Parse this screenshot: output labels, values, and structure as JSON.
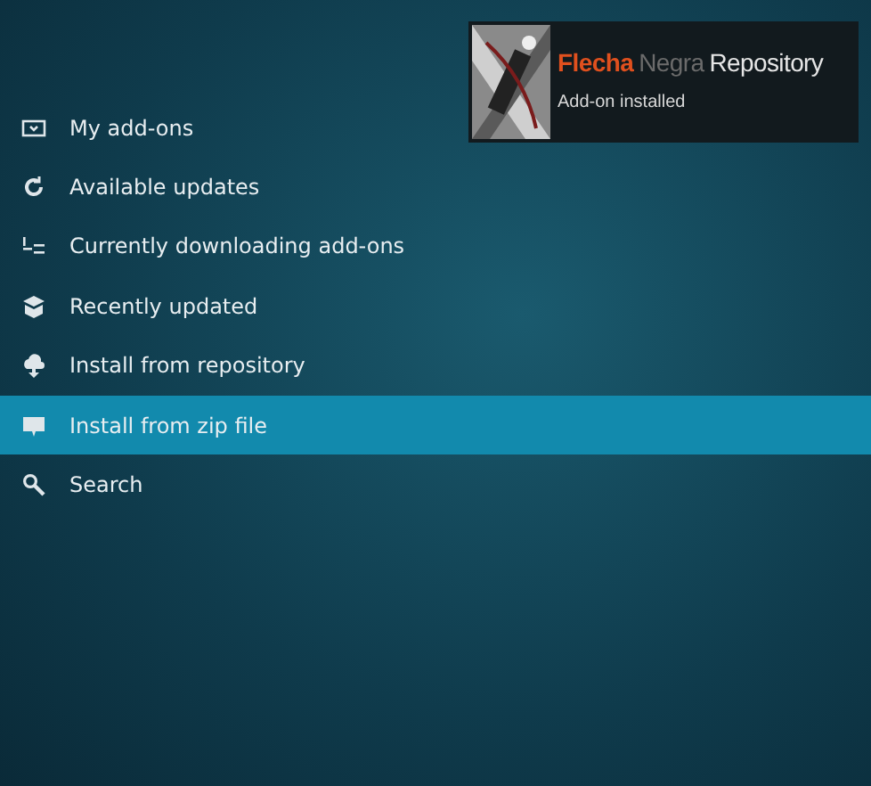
{
  "notification": {
    "title_parts": [
      {
        "text": "Flecha",
        "color": "#e0501e"
      },
      {
        "text": "Negra",
        "color": "#6b6b6b"
      },
      {
        "text": "Repository",
        "color": "#e6e6e6"
      }
    ],
    "message": "Add-on installed"
  },
  "menu": [
    {
      "label": "My add-ons",
      "kind": "box",
      "selected": false
    },
    {
      "label": "Available updates",
      "kind": "refresh",
      "selected": false
    },
    {
      "label": "Currently downloading add-ons",
      "kind": "download",
      "selected": false
    },
    {
      "label": "Recently updated",
      "kind": "package",
      "selected": false
    },
    {
      "label": "Install from repository",
      "kind": "cloud",
      "selected": false
    },
    {
      "label": "Install from zip file",
      "kind": "zip",
      "selected": true
    },
    {
      "label": "Search",
      "kind": "search",
      "selected": false
    }
  ]
}
